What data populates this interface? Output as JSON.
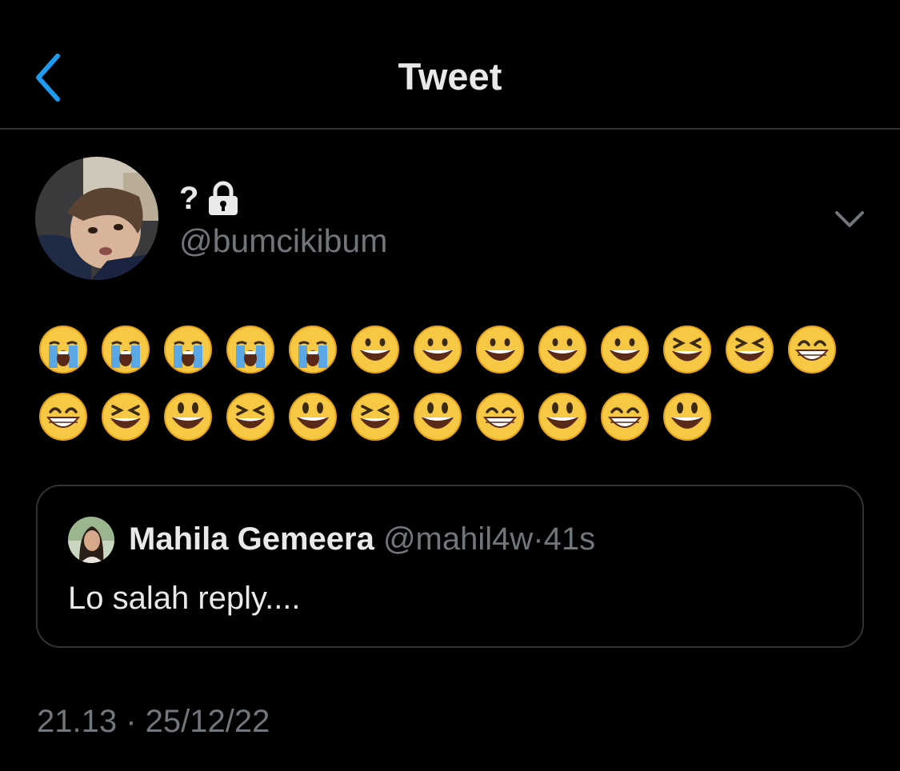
{
  "header": {
    "title": "Tweet"
  },
  "author": {
    "name": "?",
    "handle": "@bumcikibum",
    "protected": true
  },
  "tweet": {
    "emojis_row1": [
      "crying",
      "crying",
      "crying",
      "crying",
      "crying",
      "grinning",
      "grinning",
      "grinning",
      "grinning",
      "grinning",
      "squinting",
      "squinting",
      "beaming"
    ],
    "emojis_row2": [
      "beaming",
      "squinting",
      "grin-big",
      "squinting",
      "grin-big",
      "squinting",
      "grin-big",
      "beaming",
      "grin-big",
      "beaming",
      "grin-big"
    ]
  },
  "quote": {
    "name": "Mahila Gemeera",
    "handle": "@mahil4w",
    "separator": "·",
    "time": "41s",
    "text": "Lo salah reply...."
  },
  "meta": {
    "timestamp": "21.13 · 25/12/22"
  },
  "colors": {
    "accent": "#1d9bf0",
    "background": "#000000",
    "muted": "#71767b",
    "border": "#2f3336"
  }
}
